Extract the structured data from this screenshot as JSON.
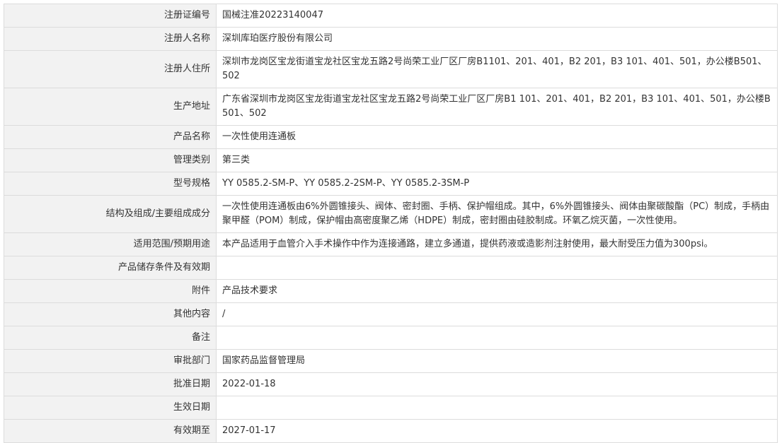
{
  "records": [
    {
      "label": "注册证编号",
      "value": "国械注准20223140047"
    },
    {
      "label": "注册人名称",
      "value": "深圳库珀医疗股份有限公司"
    },
    {
      "label": "注册人住所",
      "value": "深圳市龙岗区宝龙街道宝龙社区宝龙五路2号尚荣工业厂区厂房B1101、201、401，B2 201，B3 101、401、501，办公楼B501、502"
    },
    {
      "label": "生产地址",
      "value": "广东省深圳市龙岗区宝龙街道宝龙社区宝龙五路2号尚荣工业厂区厂房B1 101、201、401，B2 201，B3 101、401、501，办公楼B501、502"
    },
    {
      "label": "产品名称",
      "value": "一次性使用连通板"
    },
    {
      "label": "管理类别",
      "value": "第三类"
    },
    {
      "label": "型号规格",
      "value": "YY 0585.2-SM-P、YY 0585.2-2SM-P、YY 0585.2-3SM-P"
    },
    {
      "label": "结构及组成/主要组成成分",
      "value": "一次性使用连通板由6%外圆锥接头、阀体、密封圈、手柄、保护帽组成。其中，6%外圆锥接头、阀体由聚碳酸酯（PC）制成，手柄由聚甲醛（POM）制成，保护帽由高密度聚乙烯（HDPE）制成，密封圈由硅胶制成。环氧乙烷灭菌，一次性使用。"
    },
    {
      "label": "适用范围/预期用途",
      "value": "本产品适用于血管介入手术操作中作为连接通路，建立多通道，提供药液或造影剂注射使用，最大耐受压力值为300psi。"
    },
    {
      "label": "产品储存条件及有效期",
      "value": ""
    },
    {
      "label": "附件",
      "value": "产品技术要求"
    },
    {
      "label": "其他内容",
      "value": "/"
    },
    {
      "label": "备注",
      "value": ""
    },
    {
      "label": "审批部门",
      "value": "国家药品监督管理局"
    },
    {
      "label": "批准日期",
      "value": "2022-01-18"
    },
    {
      "label": "生效日期",
      "value": ""
    },
    {
      "label": "有效期至",
      "value": "2027-01-17"
    }
  ]
}
